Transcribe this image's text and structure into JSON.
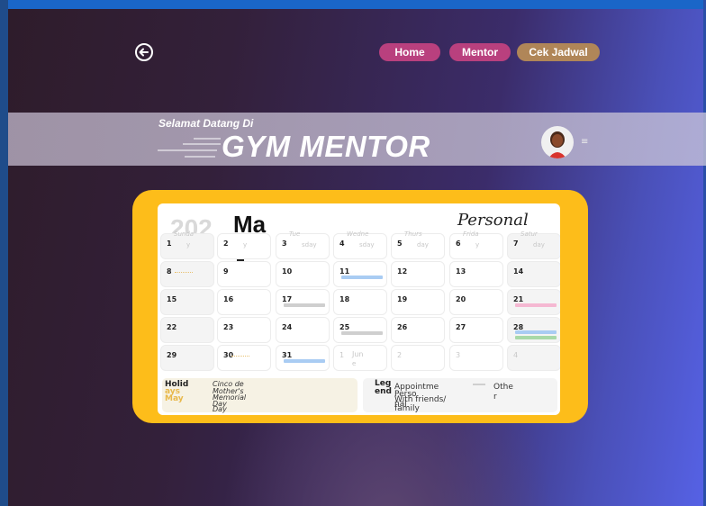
{
  "header": {
    "nav": [
      "Home",
      "Mentor",
      "Cek Jadwal"
    ],
    "welcome": "Selamat Datang  Di",
    "brand": "GYM MENTOR",
    "menu_glyph": "≡"
  },
  "calendar": {
    "year_label": "202",
    "month_label": "Ma",
    "personal_label": "Personal",
    "days": [
      {
        "num": "1",
        "name": "Sunda",
        "sub": "y",
        "gray": true
      },
      {
        "num": "2",
        "sub": "y"
      },
      {
        "num": "3",
        "name": "Tue",
        "sub": "sday"
      },
      {
        "num": "4",
        "name": "Wedne",
        "sub": "sday"
      },
      {
        "num": "5",
        "name": "Thurs",
        "sub": "day"
      },
      {
        "num": "6",
        "name": "Frida",
        "sub": "y"
      },
      {
        "num": "7",
        "name": "Satur",
        "sub": "day",
        "gray": true
      },
      {
        "num": "8",
        "gray": true
      },
      {
        "num": "9"
      },
      {
        "num": "10"
      },
      {
        "num": "11"
      },
      {
        "num": "12"
      },
      {
        "num": "13"
      },
      {
        "num": "14",
        "gray": true
      },
      {
        "num": "15",
        "gray": true
      },
      {
        "num": "16"
      },
      {
        "num": "17"
      },
      {
        "num": "18"
      },
      {
        "num": "19"
      },
      {
        "num": "20"
      },
      {
        "num": "21",
        "gray": true
      },
      {
        "num": "22",
        "gray": true
      },
      {
        "num": "23"
      },
      {
        "num": "24"
      },
      {
        "num": "25"
      },
      {
        "num": "26"
      },
      {
        "num": "27"
      },
      {
        "num": "28",
        "gray": true
      },
      {
        "num": "29",
        "gray": true
      },
      {
        "num": "30"
      },
      {
        "num": "31"
      },
      {
        "num": "1",
        "sub": "Jun",
        "sub2": "e",
        "faded": true
      },
      {
        "num": "2",
        "faded": true
      },
      {
        "num": "3",
        "faded": true
      },
      {
        "num": "4",
        "faded": true,
        "gray": true
      }
    ],
    "legend": {
      "holiday_title_1": "Holid",
      "holiday_title_2": "ays",
      "holiday_title_3": "May",
      "holiday_items": [
        "Cinco de",
        "Mother's",
        "Memorial",
        "Day",
        "Day"
      ],
      "legend_title_1": "Leg",
      "legend_title_2": "end",
      "appointment": "Appointme",
      "personal": "Perso",
      "personal_2": "nal",
      "friends": "With friends/",
      "family": "family",
      "other_1": "Othe",
      "other_2": "r"
    },
    "colors": {
      "appointment": "#a9ccf3",
      "personal": "#cfcfcf",
      "friends": "#f5b8d2",
      "family": "#a8d9a8",
      "frame": "#fdbd1a"
    }
  },
  "icons": [
    "arrow-left-circle-icon",
    "avatar-icon",
    "menu-icon"
  ]
}
